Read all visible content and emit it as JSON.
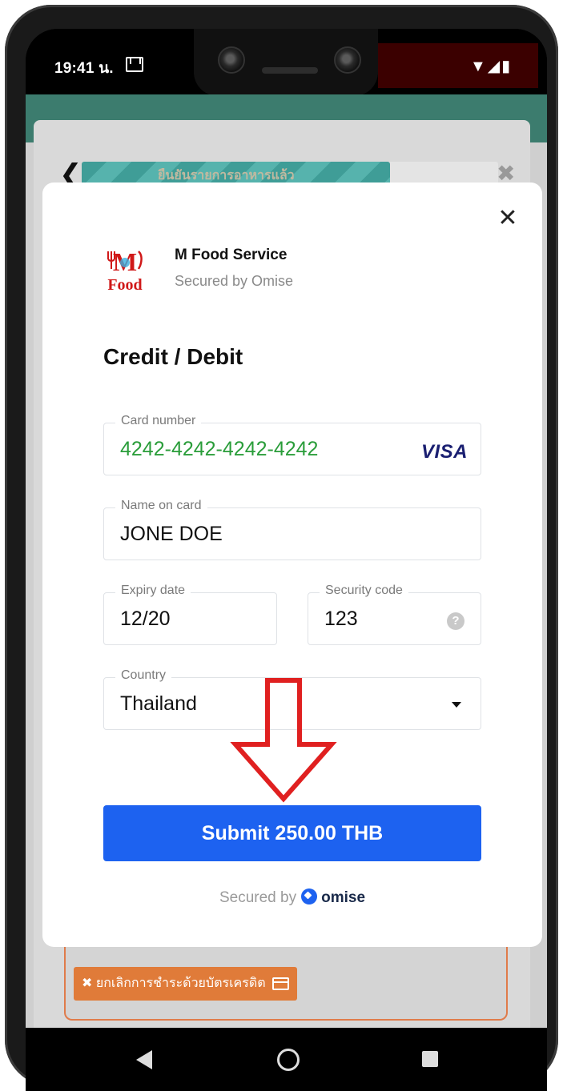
{
  "status_bar": {
    "time": "19:41 น.",
    "icons": "▼◢▮"
  },
  "background_app": {
    "progress_label": "ยืนยันรายการอาหารแล้ว",
    "progress_fraction": 0.74,
    "cancel_button_label": "✖ ยกเลิกการชำระด้วยบัตรเครดิต"
  },
  "payment_modal": {
    "merchant_name": "M Food Service",
    "merchant_subtitle": "Secured by Omise",
    "logo_text_top": "M",
    "logo_text_bottom": "Food",
    "section_title": "Credit / Debit",
    "fields": {
      "card_number": {
        "label": "Card number",
        "value": "4242-4242-4242-4242",
        "brand": "VISA"
      },
      "name_on_card": {
        "label": "Name on card",
        "value": "JONE DOE"
      },
      "expiry_date": {
        "label": "Expiry date",
        "value": "12/20"
      },
      "security_code": {
        "label": "Security code",
        "value": "123",
        "help": "?"
      },
      "country": {
        "label": "Country",
        "value": "Thailand"
      }
    },
    "submit_label": "Submit 250.00 THB",
    "footer_prefix": "Secured by",
    "footer_brand": "omise"
  },
  "colors": {
    "submit_blue": "#1d62f0",
    "card_number_green": "#2a9d3a",
    "cancel_orange": "#e07b39",
    "annotation_red": "#e02020"
  }
}
